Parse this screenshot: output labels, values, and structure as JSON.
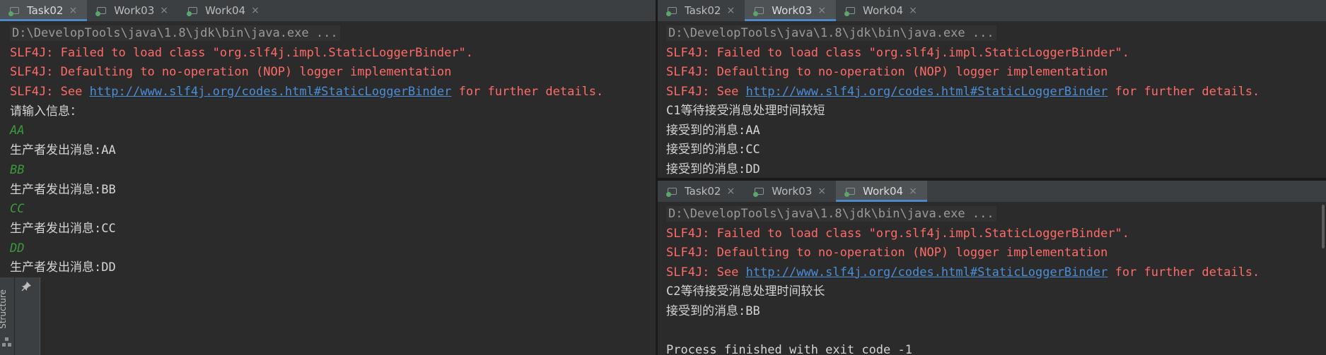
{
  "left_pane": {
    "tabs": [
      {
        "label": "Task02",
        "active": true,
        "close": "×"
      },
      {
        "label": "Work03",
        "active": false,
        "close": "×"
      },
      {
        "label": "Work04",
        "active": false,
        "close": "×"
      }
    ],
    "lines": [
      {
        "type": "cmd",
        "text": "D:\\DevelopTools\\java\\1.8\\jdk\\bin\\java.exe ..."
      },
      {
        "type": "err",
        "text": "SLF4J: Failed to load class \"org.slf4j.impl.StaticLoggerBinder\"."
      },
      {
        "type": "err",
        "text": "SLF4J: Defaulting to no-operation (NOP) logger implementation"
      },
      {
        "type": "link",
        "pre": "SLF4J: See ",
        "link": "http://www.slf4j.org/codes.html#StaticLoggerBinder",
        "post": " for further details."
      },
      {
        "type": "out",
        "text": "请输入信息："
      },
      {
        "type": "inp",
        "text": "AA"
      },
      {
        "type": "out",
        "text": "生产者发出消息:AA"
      },
      {
        "type": "inp",
        "text": "BB"
      },
      {
        "type": "out",
        "text": "生产者发出消息:BB"
      },
      {
        "type": "inp",
        "text": "CC"
      },
      {
        "type": "out",
        "text": "生产者发出消息:CC"
      },
      {
        "type": "inp",
        "text": "DD"
      },
      {
        "type": "out",
        "text": "生产者发出消息:DD"
      }
    ]
  },
  "structure_panel": {
    "label": "Structure",
    "pin_icon": "pin-icon",
    "structure_icon": "structure-icon"
  },
  "right_top_pane": {
    "tabs": [
      {
        "label": "Task02",
        "active": false,
        "close": "×"
      },
      {
        "label": "Work03",
        "active": true,
        "close": "×"
      },
      {
        "label": "Work04",
        "active": false,
        "close": "×"
      }
    ],
    "lines": [
      {
        "type": "cmd",
        "text": "D:\\DevelopTools\\java\\1.8\\jdk\\bin\\java.exe ..."
      },
      {
        "type": "err",
        "text": "SLF4J: Failed to load class \"org.slf4j.impl.StaticLoggerBinder\"."
      },
      {
        "type": "err",
        "text": "SLF4J: Defaulting to no-operation (NOP) logger implementation"
      },
      {
        "type": "link",
        "pre": "SLF4J: See ",
        "link": "http://www.slf4j.org/codes.html#StaticLoggerBinder",
        "post": " for further details."
      },
      {
        "type": "out",
        "text": "C1等待接受消息处理时间较短"
      },
      {
        "type": "out",
        "text": "接受到的消息:AA"
      },
      {
        "type": "out",
        "text": "接受到的消息:CC"
      },
      {
        "type": "out",
        "text": "接受到的消息:DD"
      }
    ]
  },
  "right_bottom_pane": {
    "tabs": [
      {
        "label": "Task02",
        "active": false,
        "close": "×"
      },
      {
        "label": "Work03",
        "active": false,
        "close": "×"
      },
      {
        "label": "Work04",
        "active": true,
        "close": "×"
      }
    ],
    "lines": [
      {
        "type": "cmd",
        "text": "D:\\DevelopTools\\java\\1.8\\jdk\\bin\\java.exe ..."
      },
      {
        "type": "err",
        "text": "SLF4J: Failed to load class \"org.slf4j.impl.StaticLoggerBinder\"."
      },
      {
        "type": "err",
        "text": "SLF4J: Defaulting to no-operation (NOP) logger implementation"
      },
      {
        "type": "link",
        "pre": "SLF4J: See ",
        "link": "http://www.slf4j.org/codes.html#StaticLoggerBinder",
        "post": " for further details."
      },
      {
        "type": "out",
        "text": "C2等待接受消息处理时间较长"
      },
      {
        "type": "out",
        "text": "接受到的消息:BB"
      },
      {
        "type": "out",
        "text": ""
      },
      {
        "type": "out",
        "text": "Process finished with exit code -1"
      }
    ]
  },
  "colors": {
    "error": "#ff6b68",
    "link": "#4a8ed8",
    "input_echo": "#3a9a3a",
    "text": "#bbbbbb",
    "background": "#2b2b2b",
    "tab_accent": "#4a88c7"
  }
}
